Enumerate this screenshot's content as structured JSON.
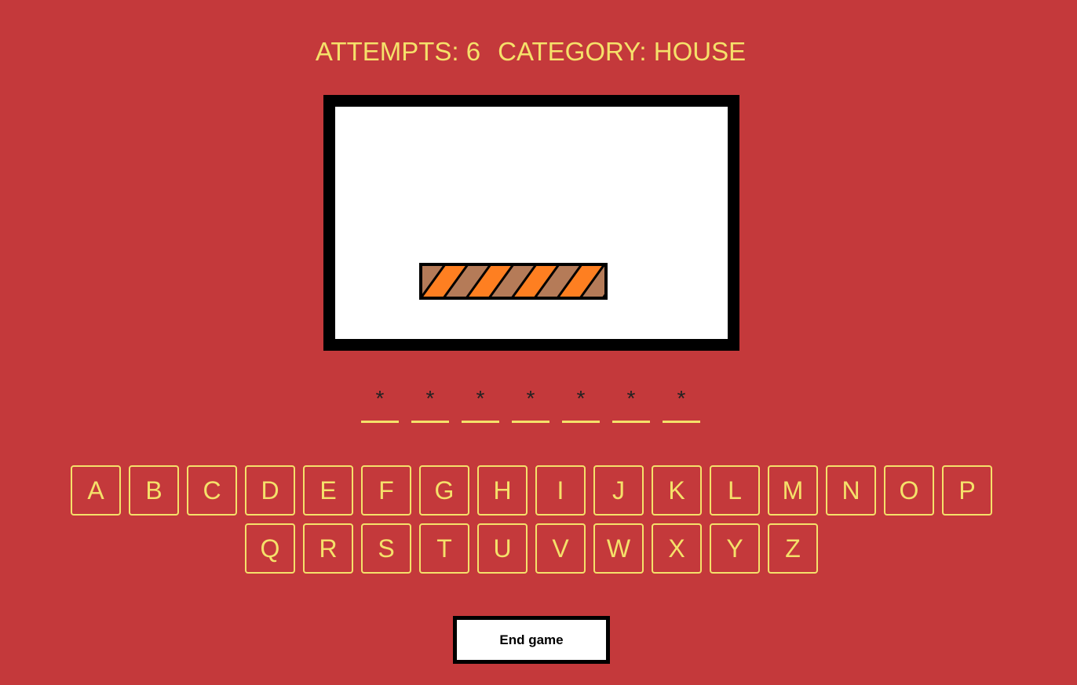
{
  "status": {
    "attempts_label": "ATTEMPTS: 6",
    "category_label": "CATEGORY: HOUSE"
  },
  "board": {
    "icon": "striped-plank-icon",
    "colors": {
      "frame": "#000000",
      "canvas": "#ffffff",
      "stripe_a": "#b57b58",
      "stripe_b": "#fe7f21"
    }
  },
  "word": {
    "slots": [
      "*",
      "*",
      "*",
      "*",
      "*",
      "*",
      "*"
    ]
  },
  "keyboard": {
    "rows": [
      [
        "A",
        "B",
        "C",
        "D",
        "E",
        "F",
        "G",
        "H",
        "I",
        "J",
        "K",
        "L",
        "M",
        "N",
        "O",
        "P"
      ],
      [
        "Q",
        "R",
        "S",
        "T",
        "U",
        "V",
        "W",
        "X",
        "Y",
        "Z"
      ]
    ]
  },
  "actions": {
    "end_game_label": "End game"
  },
  "colors": {
    "background": "#c4393b",
    "accent": "#f5e16a"
  }
}
